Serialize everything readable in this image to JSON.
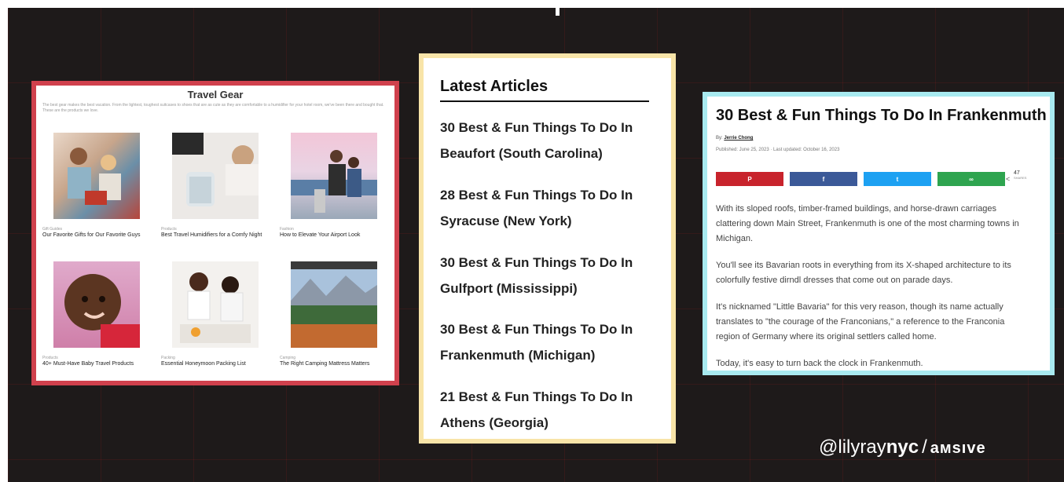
{
  "travel_gear": {
    "title": "Travel Gear",
    "description": "The best gear makes the best vacation. From the lightest, toughest suitcases to shoes that are as cute as they are comfortable to a humidifier for your hotel room, we've been there and bought that. These are the products we love.",
    "items": [
      {
        "category": "Gift Guides",
        "title": "Our Favorite Gifts for Our Favorite Guys"
      },
      {
        "category": "Products",
        "title": "Best Travel Humidifiers for a Comfy Night"
      },
      {
        "category": "Fashion",
        "title": "How to Elevate Your Airport Look"
      },
      {
        "category": "Products",
        "title": "40+ Must-Have Baby Travel Products"
      },
      {
        "category": "Packing",
        "title": "Essential Honeymoon Packing List"
      },
      {
        "category": "Camping",
        "title": "The Right Camping Mattress Matters"
      }
    ]
  },
  "latest_articles": {
    "heading": "Latest Articles",
    "items": [
      {
        "line1": "30 Best & Fun Things To Do In",
        "line2": "Beaufort (South Carolina)"
      },
      {
        "line1": "28 Best & Fun Things To Do In",
        "line2": "Syracuse (New York)"
      },
      {
        "line1": "30 Best & Fun Things To Do In",
        "line2": "Gulfport (Mississippi)"
      },
      {
        "line1": "30 Best & Fun Things To Do In",
        "line2": "Frankenmuth (Michigan)"
      },
      {
        "line1": "21 Best & Fun Things To Do In",
        "line2": "Athens (Georgia)"
      }
    ]
  },
  "article": {
    "title": "30 Best & Fun Things To Do In Frankenmuth",
    "by_label": "By:",
    "author": "Jerrie Chong",
    "dates": "Published: June 25, 2023 · Last updated: October 16, 2023",
    "share_count": "47",
    "share_label": "SHARES",
    "share_buttons": [
      {
        "icon": "pinterest-icon",
        "glyph": "P",
        "color": "#c8232c"
      },
      {
        "icon": "facebook-icon",
        "glyph": "f",
        "color": "#3b5998"
      },
      {
        "icon": "twitter-icon",
        "glyph": "t",
        "color": "#1da1f2"
      },
      {
        "icon": "share-link-icon",
        "glyph": "∞",
        "color": "#2ea44f"
      }
    ],
    "paragraphs": [
      "With its sloped roofs, timber-framed buildings, and horse-drawn carriages clattering down Main Street, Frankenmuth is one of the most charming towns in Michigan.",
      "You'll see its Bavarian roots in everything from its X-shaped architecture to its colorfully festive dirndl dresses that come out on parade days.",
      "It's nicknamed \"Little Bavaria\" for this very reason, though its name actually translates to \"the courage of the Franconians,\" a reference to the Franconia region of Germany where its original settlers called home.",
      "Today, it's easy to turn back the clock in Frankenmuth."
    ]
  },
  "brand": {
    "handle_prefix": "@lilyray",
    "handle_suffix": "nyc",
    "separator": "/",
    "company": "aмsıve"
  },
  "colors": {
    "gear_border": "#d0414d",
    "latest_border": "#f8e4a8",
    "article_border": "#a8eaf0",
    "background": "#1e1a1a"
  }
}
